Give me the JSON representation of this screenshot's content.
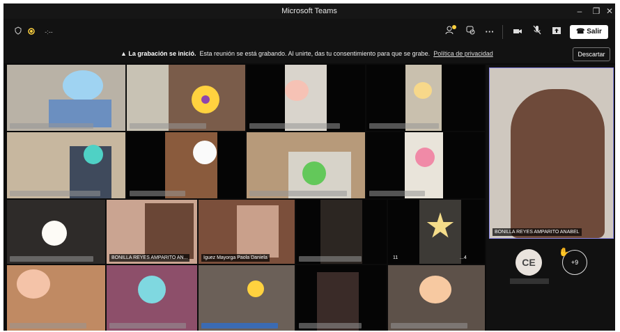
{
  "window": {
    "title": "Microsoft Teams",
    "controls": [
      "–",
      "❐",
      "✕"
    ]
  },
  "toolbar": {
    "leave_label": "Salir",
    "more_label": "···"
  },
  "banner": {
    "bold": "La grabación se inició.",
    "text": "Esta reunión se está grabando. Al unirte, das tu consentimiento para que se grabe.",
    "link": "Política de privacidad",
    "dismiss": "Descartar"
  },
  "participants": {
    "host_label": "BONILLA REYES AMPARITO AN...",
    "host_full_label": "BONILLA REYES AMPARITO ANABEL",
    "paola_label": "Iguez Mayorga Paola Daniela",
    "tile_label_m": "11",
    "tile_label_dots": "...4",
    "ce_initials": "CE",
    "overflow_count": "+9"
  },
  "colors": {
    "accent": "#ffd23f",
    "bg": "#0b0b0b",
    "panel": "#111111",
    "hand": "#f3b23a"
  },
  "icons": [
    "shield-icon",
    "record-dot-icon",
    "people-icon",
    "chat-icon",
    "camera-icon",
    "mic-muted-icon",
    "share-icon",
    "phone-icon",
    "warning-icon",
    "raise-hand-icon"
  ]
}
